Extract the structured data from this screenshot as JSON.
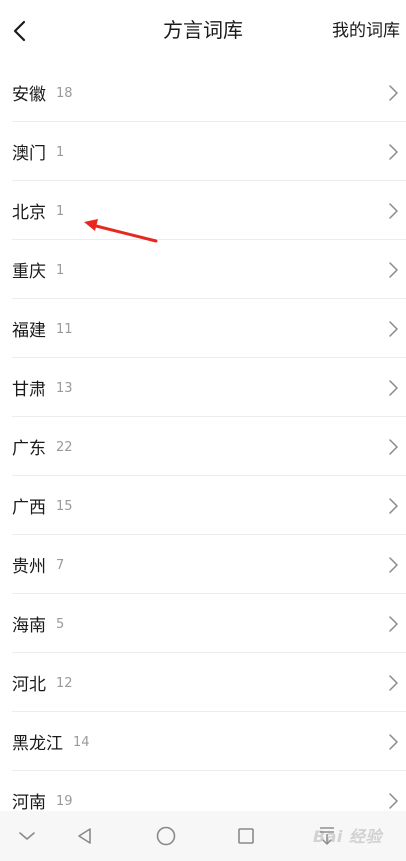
{
  "header": {
    "title": "方言词库",
    "my_lexicon": "我的词库"
  },
  "list": [
    {
      "name": "安徽",
      "count": "18"
    },
    {
      "name": "澳门",
      "count": "1"
    },
    {
      "name": "北京",
      "count": "1"
    },
    {
      "name": "重庆",
      "count": "1"
    },
    {
      "name": "福建",
      "count": "11"
    },
    {
      "name": "甘肃",
      "count": "13"
    },
    {
      "name": "广东",
      "count": "22"
    },
    {
      "name": "广西",
      "count": "15"
    },
    {
      "name": "贵州",
      "count": "7"
    },
    {
      "name": "海南",
      "count": "5"
    },
    {
      "name": "河北",
      "count": "12"
    },
    {
      "name": "黑龙江",
      "count": "14"
    },
    {
      "name": "河南",
      "count": "19"
    }
  ],
  "annotation": {
    "arrow_color": "#e8281e",
    "target": "北京"
  },
  "navbar": {
    "icons": [
      "chevron-down-icon",
      "back-triangle-icon",
      "home-circle-icon",
      "recents-square-icon",
      "download-icon"
    ]
  },
  "watermark": {
    "text": "Bai 经验"
  },
  "colors": {
    "text": "#1a1a1a",
    "count": "#9a9a9a",
    "divider": "#ececec",
    "chevron": "#8a8a8a",
    "navbar_bg": "#f7f7f7"
  }
}
